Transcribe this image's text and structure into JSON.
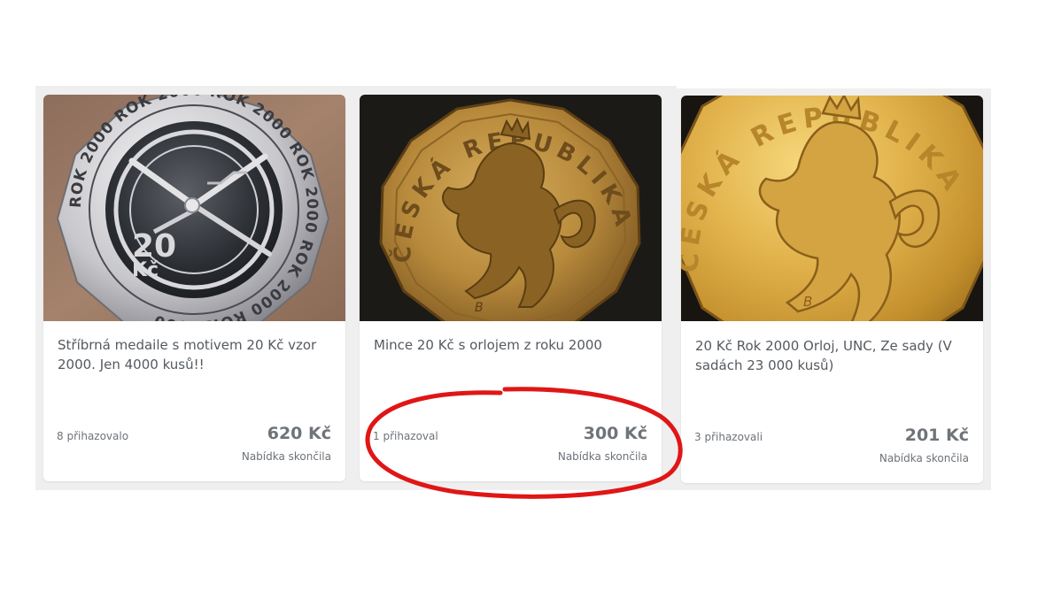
{
  "listings": [
    {
      "title": "Stříbrná medaile s motivem 20 Kč vzor 2000. Jen 4000 kusů!!",
      "bidders": "8 přihazovalo",
      "price": "620 Kč",
      "status": "Nabídka skončila",
      "image_text": {
        "rim": "ROK 2000 ROK 2000 ROK 2000 ROK 2000 ROK 2000 ROK 2000",
        "denomination": "20",
        "currency": "Kč"
      }
    },
    {
      "title": "Mince 20 Kč s orlojem z roku 2000",
      "bidders": "1 přihazoval",
      "price": "300 Kč",
      "status": "Nabídka skončila",
      "image_text": {
        "rim": "ČESKÁ REPUBLIKA",
        "mint_mark": "B"
      }
    },
    {
      "title": "20 Kč Rok 2000 Orloj, UNC, Ze sady (V sadách 23 000 kusů)",
      "bidders": "3 přihazovali",
      "price": "201 Kč",
      "status": "Nabídka skončila",
      "image_text": {
        "rim": "ČESKÁ REPUBLIKA",
        "mint_mark": "B"
      }
    }
  ],
  "colors": {
    "panel_background": "#efefef",
    "card_background": "#ffffff",
    "text": "#555a60",
    "price": "#6f747a",
    "highlight": "#e01616"
  }
}
